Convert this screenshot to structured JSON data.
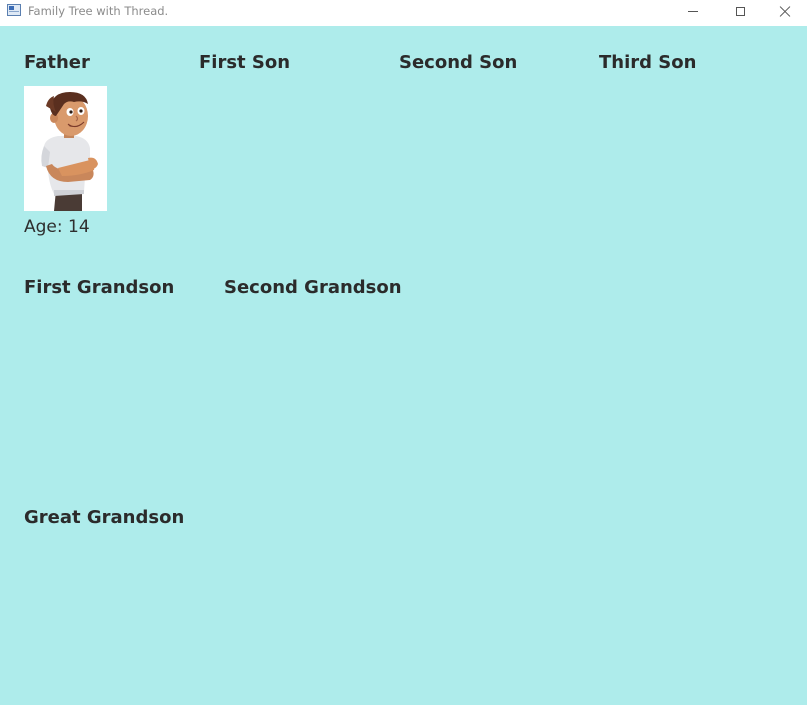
{
  "window": {
    "title": "Family Tree with Thread."
  },
  "generation1": {
    "father": "Father",
    "first_son": "First Son",
    "second_son": "Second Son",
    "third_son": "Third Son"
  },
  "father_card": {
    "age_text": "Age: 14",
    "image_icon": "boy-cartoon-avatar"
  },
  "generation2": {
    "first_grandson": "First Grandson",
    "second_grandson": "Second Grandson"
  },
  "generation3": {
    "great_grandson": "Great Grandson"
  },
  "colors": {
    "background": "#aeeceb",
    "titlebar": "#ffffff",
    "text": "#2b2b2b"
  }
}
